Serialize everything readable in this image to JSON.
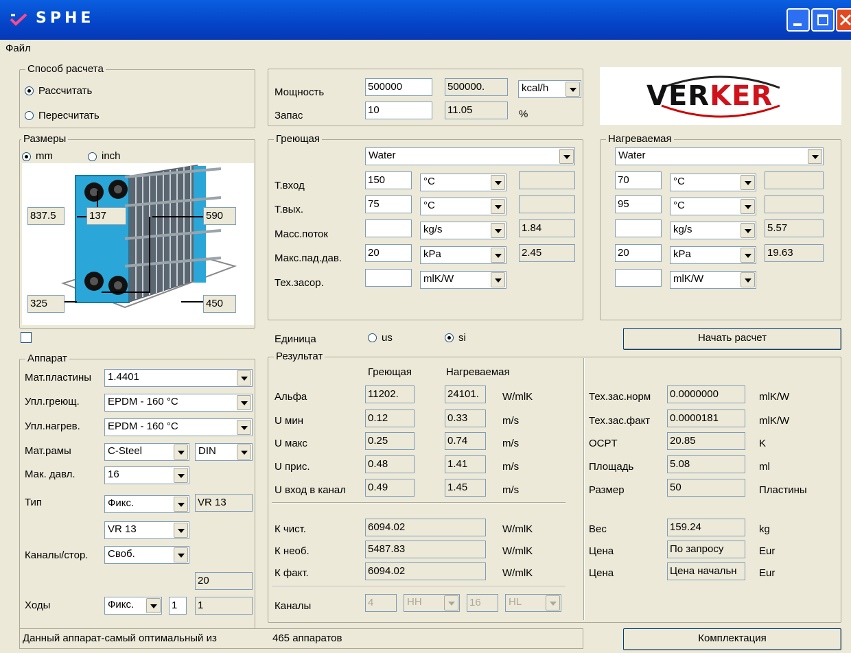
{
  "window": {
    "title": "SPHE"
  },
  "menu": {
    "file": "Файл"
  },
  "calc_method": {
    "legend": "Способ расчета",
    "calculate": "Рассчитать",
    "recalculate": "Пересчитать",
    "selected": "calculate"
  },
  "power": {
    "label": "Мощность",
    "value": "500000",
    "result": "500000.",
    "unit": "kcal/h",
    "reserve_label": "Запас",
    "reserve_value": "10",
    "reserve_result": "11.05",
    "reserve_unit": "%"
  },
  "logo": {
    "text_left": "VER",
    "text_right": "KER"
  },
  "sizes": {
    "legend": "Размеры",
    "mm": "mm",
    "inch": "inch",
    "selected": "mm",
    "d1": "837.5",
    "d2": "137",
    "d3": "590",
    "d4": "325",
    "d5": "450"
  },
  "hot": {
    "legend": "Греющая",
    "fluid": "Water",
    "t_in": "150",
    "t_in_unit": "°C",
    "t_out": "75",
    "t_out_unit": "°C",
    "flow": "",
    "flow_unit": "kg/s",
    "flow_result": "1.84",
    "dp": "20",
    "dp_unit": "kPa",
    "dp_result": "2.45",
    "fouling": "",
    "fouling_unit": "mlK/W"
  },
  "cold": {
    "legend": "Нагреваемая",
    "fluid": "Water",
    "t_in": "70",
    "t_in_unit": "°C",
    "t_out": "95",
    "t_out_unit": "°C",
    "flow": "",
    "flow_unit": "kg/s",
    "flow_result": "5.57",
    "dp": "20",
    "dp_unit": "kPa",
    "dp_result": "19.63",
    "fouling": "",
    "fouling_unit": "mlK/W"
  },
  "param_labels": {
    "t_in": "Т.вход",
    "t_out": "Т.вых.",
    "flow": "Масс.поток",
    "dp": "Макс.пад.дав.",
    "fouling": "Тех.засор."
  },
  "units": {
    "label": "Единица",
    "us": "us",
    "si": "si",
    "selected": "si"
  },
  "start_button": "Начать расчет",
  "apparatus": {
    "legend": "Аппарат",
    "plate_mat_label": "Мат.пластины",
    "plate_mat": "1.4401",
    "seal_hot_label": "Упл.греющ.",
    "seal_hot": "EPDM  - 160 °C",
    "seal_cold_label": "Упл.нагрев.",
    "seal_cold": "EPDM  - 160 °C",
    "frame_label": "Мат.рамы",
    "frame": "C-Steel",
    "frame_std": "DIN",
    "pressure_label": "Мак. давл.",
    "pressure": "16",
    "type_label": "Тип",
    "type": "Фикс.",
    "type_value": "VR 13",
    "model": "VR 13",
    "channels_label": "Каналы/стор.",
    "channels": "Своб.",
    "channels_value": "20",
    "passes_label": "Ходы",
    "passes": "Фикс.",
    "passes_a": "1",
    "passes_b": "1"
  },
  "result": {
    "legend": "Результат",
    "col_hot": "Греющая",
    "col_cold": "Нагреваемая",
    "rows": [
      {
        "label": "Альфа",
        "hot": "11202.",
        "cold": "24101.",
        "unit": "W/mlK"
      },
      {
        "label": "U мин",
        "hot": "0.12",
        "cold": "0.33",
        "unit": "m/s"
      },
      {
        "label": "U макс",
        "hot": "0.25",
        "cold": "0.74",
        "unit": "m/s"
      },
      {
        "label": "U прис.",
        "hot": "0.48",
        "cold": "1.41",
        "unit": "m/s"
      },
      {
        "label": "U вход в канал",
        "hot": "0.49",
        "cold": "1.45",
        "unit": "m/s"
      }
    ],
    "k_rows": [
      {
        "label": "К чист.",
        "value": "6094.02",
        "unit": "W/mlK"
      },
      {
        "label": "К необ.",
        "value": "5487.83",
        "unit": "W/mlK"
      },
      {
        "label": "К факт.",
        "value": "6094.02",
        "unit": "W/mlK"
      }
    ],
    "channels_label": "Каналы",
    "ch_a": "4",
    "ch_a_type": "HH",
    "ch_b": "16",
    "ch_b_type": "HL",
    "right_rows": [
      {
        "label": "Тех.зас.норм",
        "value": "0.0000000",
        "unit": "mlK/W"
      },
      {
        "label": "Тех.зас.факт",
        "value": "0.0000181",
        "unit": "mlK/W"
      },
      {
        "label": "OCPT",
        "value": "20.85",
        "unit": "K"
      },
      {
        "label": "Площадь",
        "value": "5.08",
        "unit": "ml"
      },
      {
        "label": "Размер",
        "value": "50",
        "unit": "Пластины"
      }
    ],
    "right_rows2": [
      {
        "label": "Вес",
        "value": "159.24",
        "unit": "kg"
      },
      {
        "label": "Цена",
        "value": "По запросу",
        "unit": "Eur"
      },
      {
        "label": "Цена",
        "value": "Цена начальн",
        "unit": "Eur"
      }
    ]
  },
  "status": {
    "text": "Данный аппарат-самый оптимальный из",
    "count": "465 аппаратов"
  },
  "kit_button": "Комплектация"
}
